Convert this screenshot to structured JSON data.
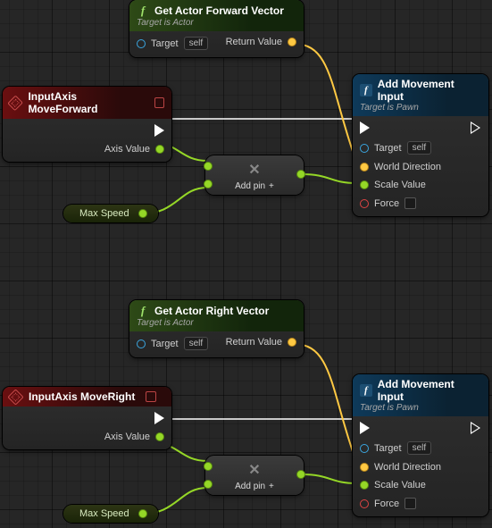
{
  "nodes": {
    "getForward": {
      "title": "Get Actor Forward Vector",
      "subtitle": "Target is Actor",
      "targetLabel": "Target",
      "targetTag": "self",
      "returnLabel": "Return Value"
    },
    "getRight": {
      "title": "Get Actor Right Vector",
      "subtitle": "Target is Actor",
      "targetLabel": "Target",
      "targetTag": "self",
      "returnLabel": "Return Value"
    },
    "inputFwd": {
      "title": "InputAxis MoveForward",
      "axisLabel": "Axis Value"
    },
    "inputRight": {
      "title": "InputAxis MoveRight",
      "axisLabel": "Axis Value"
    },
    "mult": {
      "addPin": "Add pin",
      "symbol": "✕"
    },
    "addMove": {
      "title": "Add Movement Input",
      "subtitle": "Target is Pawn",
      "targetLabel": "Target",
      "targetTag": "self",
      "worldDirLabel": "World Direction",
      "scaleLabel": "Scale Value",
      "forceLabel": "Force"
    },
    "maxSpeed": {
      "label": "Max Speed"
    }
  }
}
